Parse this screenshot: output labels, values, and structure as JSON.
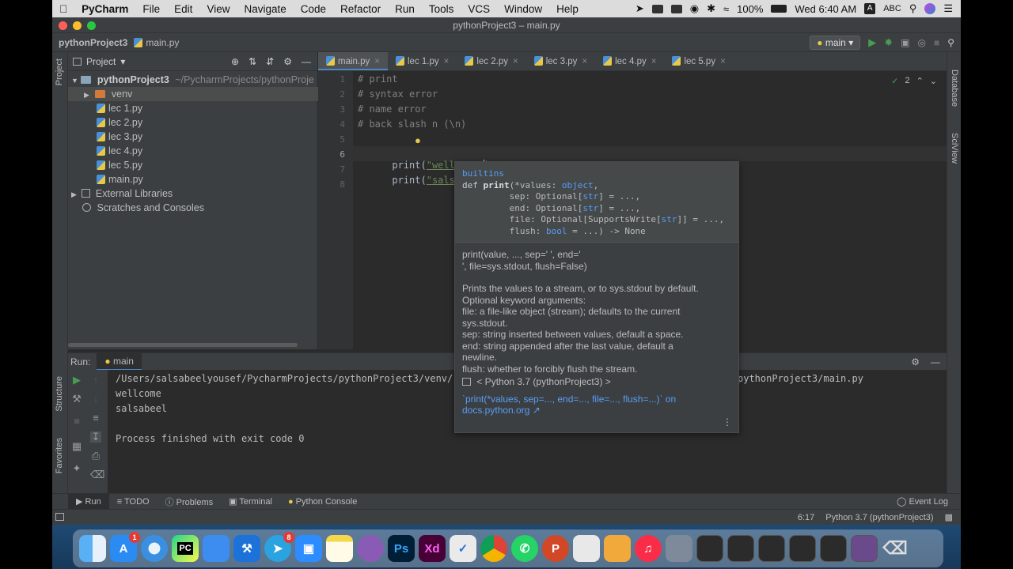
{
  "menubar": {
    "app": "PyCharm",
    "items": [
      "File",
      "Edit",
      "View",
      "Navigate",
      "Code",
      "Refactor",
      "Run",
      "Tools",
      "VCS",
      "Window",
      "Help"
    ],
    "battery": "100%",
    "clock": "Wed 6:40 AM",
    "input_source": "ABC"
  },
  "window": {
    "title": "pythonProject3 – main.py"
  },
  "navbar": {
    "project": "pythonProject3",
    "file": "main.py",
    "run_config": "main"
  },
  "left_strip": {
    "project": "Project",
    "structure": "Structure",
    "favorites": "Favorites"
  },
  "right_strip": {
    "database": "Database",
    "sciview": "SciView"
  },
  "project_panel": {
    "title": "Project",
    "root": "pythonProject3",
    "root_path": "~/PycharmProjects/pythonProje",
    "items": [
      "venv",
      "lec 1.py",
      "lec 2.py",
      "lec 3.py",
      "lec 4.py",
      "lec 5.py",
      "main.py"
    ],
    "external": "External Libraries",
    "scratches": "Scratches and Consoles"
  },
  "tabs": [
    "main.py",
    "lec 1.py",
    "lec 2.py",
    "lec 3.py",
    "lec 4.py",
    "lec 5.py"
  ],
  "editor": {
    "problems_count": "2",
    "line_numbers": [
      "1",
      "2",
      "3",
      "4",
      "5",
      "6",
      "7",
      "8"
    ],
    "comments": [
      "# print",
      "# syntax error",
      "# name error",
      "# back slash n (\\n)"
    ],
    "line6_fn": "print(",
    "line6_str": "\"wellcome ",
    "line6_end": ")",
    "line7_fn": "print(",
    "line7_str": "\"salsabeel\"",
    "line7_end": ")"
  },
  "popup": {
    "module": "builtins",
    "sig1_kw": "def ",
    "sig1_name": "print",
    "sig1_rest": "(*values: ",
    "sig1_type": "object",
    "sig1_end": ",",
    "sig2": "         sep: Optional[",
    "sig2_type": "str",
    "sig2_end": "] = ...,",
    "sig3": "         end: Optional[",
    "sig3_type": "str",
    "sig3_end": "] = ...,",
    "sig4": "         file: Optional[SupportsWrite[",
    "sig4_type": "str",
    "sig4_end": "]] = ...,",
    "sig5": "         flush: ",
    "sig5_type": "bool",
    "sig5_end": " = ...) -> None",
    "doc_sig1": "print(value, ..., sep=' ', end='",
    "doc_sig2": "', file=sys.stdout, flush=False)",
    "doc_lines": [
      "Prints the values to a stream, or to sys.stdout by default.",
      "Optional keyword arguments:",
      "file: a file-like object (stream); defaults to the current",
      "sys.stdout.",
      "sep: string inserted between values, default a space.",
      "end: string appended after the last value, default a",
      "newline.",
      "flush: whether to forcibly flush the stream."
    ],
    "sdk": "< Python 3.7 (pythonProject3) >",
    "link1": "`print(*values, sep=..., end=..., file=..., flush=...)` on",
    "link2": "docs.python.org ↗"
  },
  "run": {
    "label": "Run:",
    "tab": "main",
    "cmd_left": "/Users/salsabeelyousef/PycharmProjects/pythonProject3/venv/",
    "cmd_right": "pythonProject3/main.py",
    "out1": "wellcome",
    "out2": "salsabeel",
    "finished": "Process finished with exit code 0"
  },
  "bottombar": {
    "run": "Run",
    "todo": "TODO",
    "problems": "Problems",
    "terminal": "Terminal",
    "console": "Python Console",
    "event_log": "Event Log"
  },
  "statusbar": {
    "position": "6:17",
    "interpreter": "Python 3.7 (pythonProject3)"
  },
  "dock": {
    "pycharm": "PC",
    "photoshop": "Ps",
    "xd": "Xd",
    "appstore_badge": "1",
    "telegram_badge": "8"
  }
}
